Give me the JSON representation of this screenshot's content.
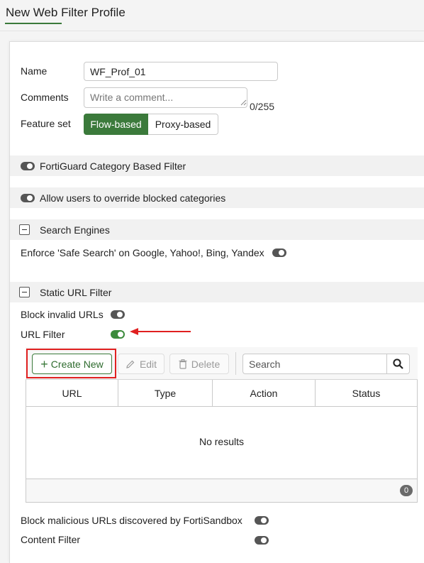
{
  "header": {
    "title": "New Web Filter Profile"
  },
  "form": {
    "name_label": "Name",
    "name_value": "WF_Prof_01",
    "comments_label": "Comments",
    "comments_placeholder": "Write a comment...",
    "comments_counter": "0/255",
    "feature_set_label": "Feature set",
    "feature_set_options": [
      "Flow-based",
      "Proxy-based"
    ],
    "feature_set_selected": "Flow-based"
  },
  "sections": {
    "fortiguard": {
      "label": "FortiGuard Category Based Filter",
      "enabled": false
    },
    "override": {
      "label": "Allow users to override blocked categories",
      "enabled": false
    },
    "search_engines": {
      "title": "Search Engines",
      "safe_search_label": "Enforce 'Safe Search' on Google, Yahoo!, Bing, Yandex",
      "safe_search_enabled": false
    },
    "static_url": {
      "title": "Static URL Filter",
      "block_invalid_label": "Block invalid URLs",
      "block_invalid_enabled": false,
      "url_filter_label": "URL Filter",
      "url_filter_enabled": true
    }
  },
  "url_table": {
    "create_new_label": "Create New",
    "edit_label": "Edit",
    "delete_label": "Delete",
    "search_placeholder": "Search",
    "columns": [
      "URL",
      "Type",
      "Action",
      "Status"
    ],
    "empty_text": "No results",
    "count": "0"
  },
  "bottom": {
    "sandbox_label": "Block malicious URLs discovered by FortiSandbox",
    "sandbox_enabled": false,
    "content_filter_label": "Content Filter",
    "content_filter_enabled": false
  },
  "colors": {
    "accent": "#3b7a3b",
    "highlight": "#e02020"
  }
}
